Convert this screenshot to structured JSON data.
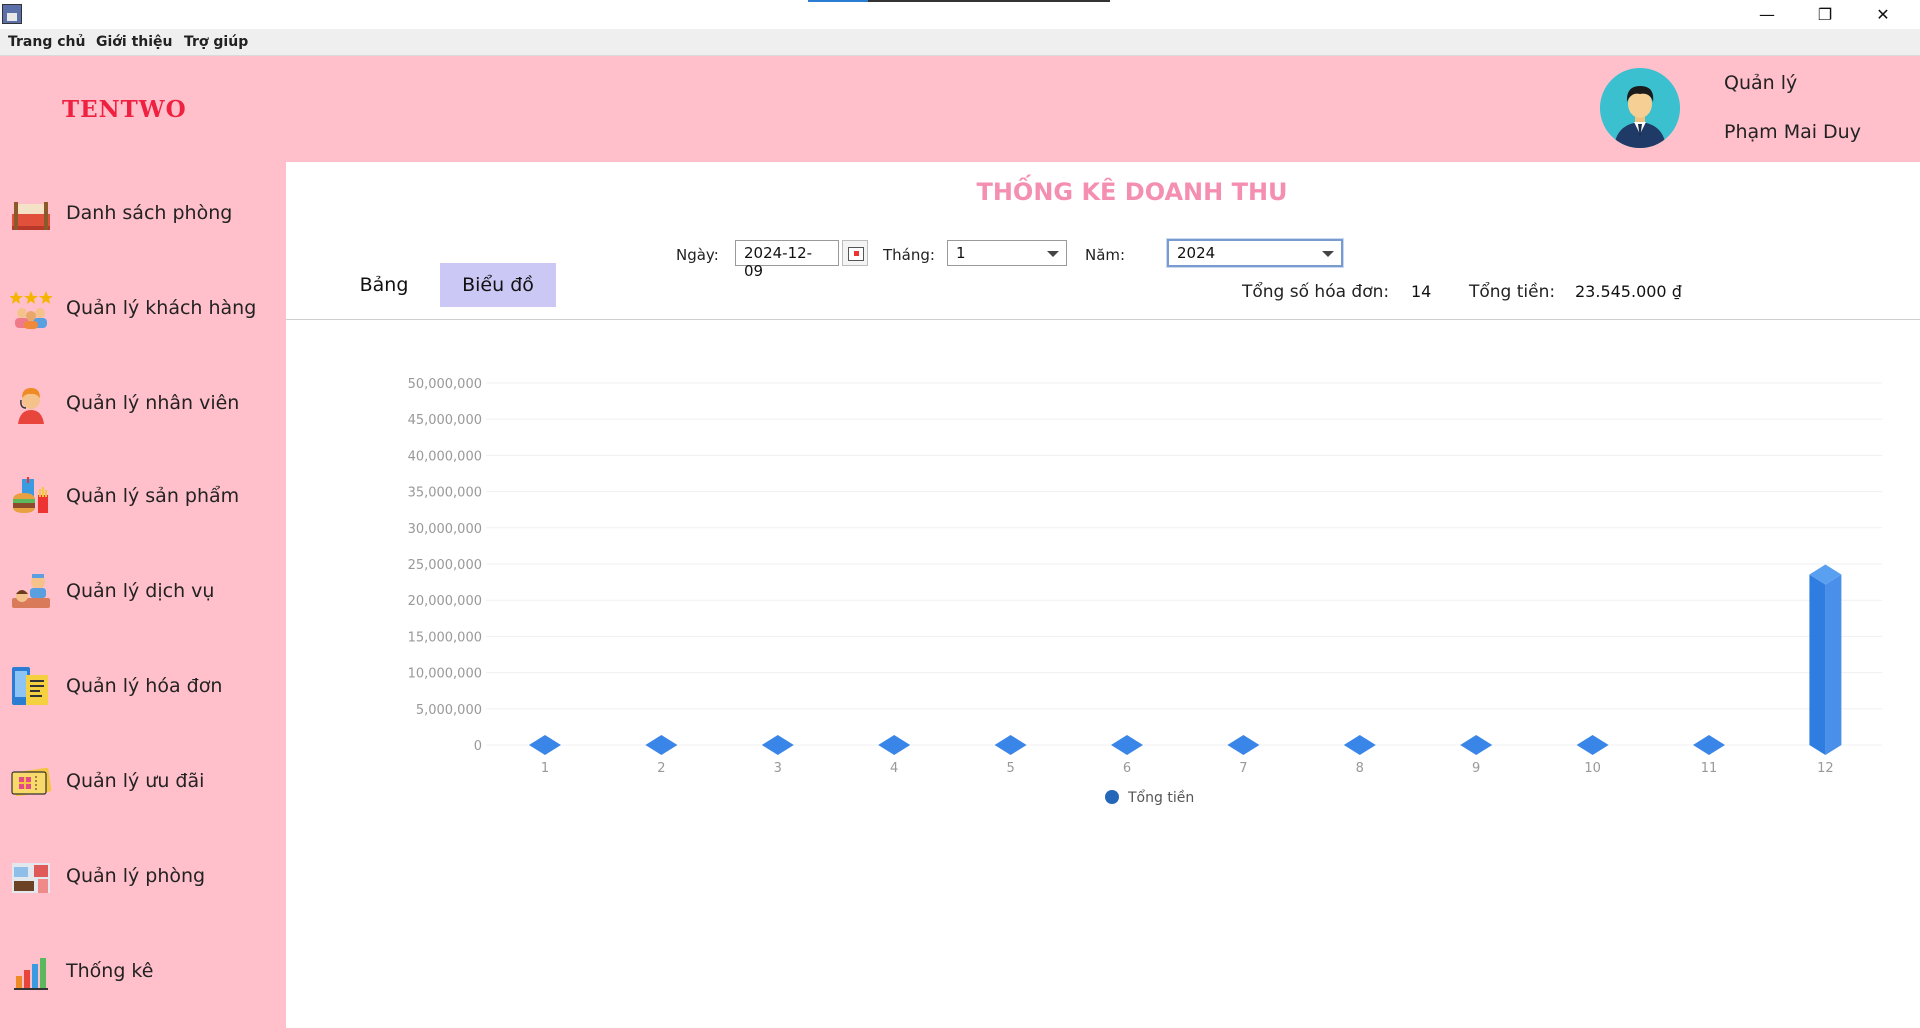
{
  "window": {
    "minimize": "—",
    "maximize": "❐",
    "close": "✕"
  },
  "menu": [
    "Trang chủ",
    "Giới thiệu",
    "Trợ giúp"
  ],
  "header": {
    "brand": "TENTWO",
    "role": "Quản lý",
    "user_name": "Phạm Mai Duy"
  },
  "sidebar": {
    "items": [
      {
        "label": "Danh sách phòng",
        "icon": "bed-icon"
      },
      {
        "label": "Quản lý khách hàng",
        "icon": "customers-icon"
      },
      {
        "label": "Quản lý nhân viên",
        "icon": "staff-icon"
      },
      {
        "label": "Quản lý sản phẩm",
        "icon": "food-icon"
      },
      {
        "label": "Quản lý dịch vụ",
        "icon": "service-icon"
      },
      {
        "label": "Quản lý hóa đơn",
        "icon": "invoice-icon"
      },
      {
        "label": "Quản lý ưu đãi",
        "icon": "voucher-icon"
      },
      {
        "label": "Quản lý phòng",
        "icon": "room-icon"
      },
      {
        "label": "Thống kê",
        "icon": "stats-icon"
      }
    ]
  },
  "main": {
    "title": "THỐNG KÊ DOANH THU",
    "filters": {
      "date_label": "Ngày:",
      "date_value": "2024-12-09",
      "month_label": "Tháng:",
      "month_value": "1",
      "year_label": "Năm:",
      "year_value": "2024"
    },
    "tabs": [
      {
        "label": "Bảng",
        "active": false
      },
      {
        "label": "Biểu đồ",
        "active": true
      }
    ],
    "summary": {
      "invoices_label": "Tổng số hóa đơn:",
      "invoices_value": "14",
      "total_label": "Tổng tiền:",
      "total_value": "23.545.000 ₫"
    }
  },
  "chart_data": {
    "type": "bar",
    "categories": [
      "1",
      "2",
      "3",
      "4",
      "5",
      "6",
      "7",
      "8",
      "9",
      "10",
      "11",
      "12"
    ],
    "series": [
      {
        "name": "Tổng tiền",
        "values": [
          0,
          0,
          0,
          0,
          0,
          0,
          0,
          0,
          0,
          0,
          0,
          23545000
        ],
        "color": "#3a86e8"
      }
    ],
    "y_ticks": [
      "0",
      "5,000,000",
      "10,000,000",
      "15,000,000",
      "20,000,000",
      "25,000,000",
      "30,000,000",
      "35,000,000",
      "40,000,000",
      "45,000,000",
      "50,000,000"
    ],
    "ylim": [
      0,
      50000000
    ],
    "grid": true,
    "legend": "bottom"
  }
}
